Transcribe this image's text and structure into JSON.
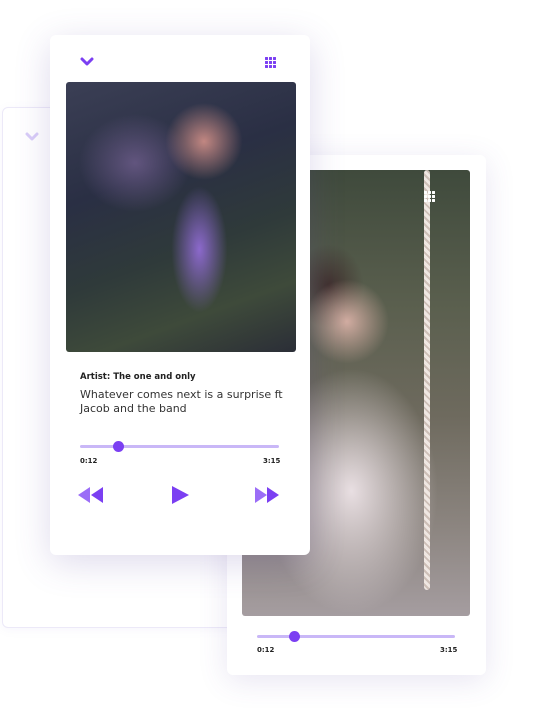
{
  "player_front": {
    "artist": "Artist: The one and only",
    "song": "Whatever comes next is a surprise ft Jacob and the band",
    "time_current": "0:12",
    "time_total": "3:15",
    "progress": 0.19
  },
  "player_back": {
    "time_current": "0:12",
    "time_total": "3:15",
    "progress": 0.19
  },
  "icons": {
    "collapse": "chevron-down-icon",
    "menu": "grid-icon",
    "rewind": "rewind-icon",
    "play": "play-icon",
    "fast_forward": "fast-forward-icon"
  },
  "colors": {
    "accent": "#7b3ff2",
    "track": "#c9b7f7",
    "card": "#ffffff"
  }
}
